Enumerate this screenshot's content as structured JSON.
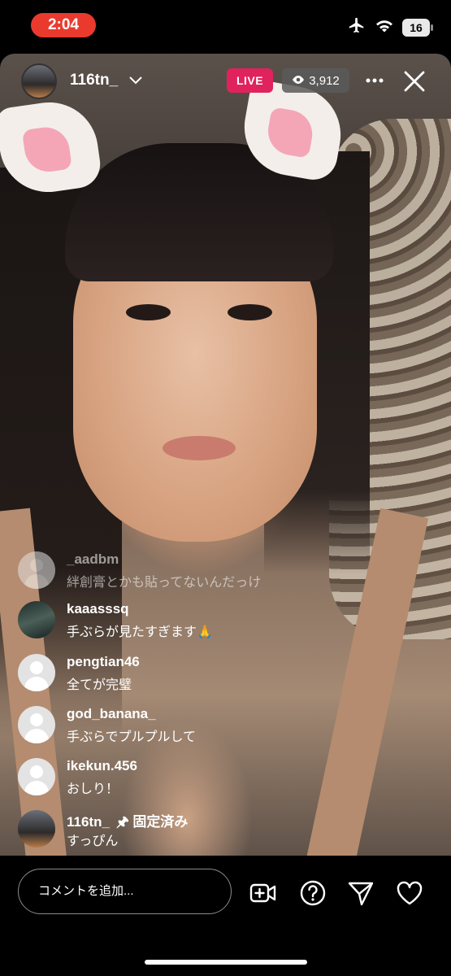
{
  "status_bar": {
    "time": "2:04",
    "battery": "16",
    "icons": [
      "airplane-icon",
      "wifi-icon",
      "battery-icon"
    ]
  },
  "live_header": {
    "host_username": "116tn_",
    "live_label": "LIVE",
    "viewer_count": "3,912",
    "colors": {
      "live_badge": "#e0225d",
      "viewer_badge": "#5a5a5a"
    }
  },
  "comments": [
    {
      "username": "_aadbm",
      "text": "絆創膏とかも貼ってないんだっけ",
      "avatar": "generic",
      "faded": true
    },
    {
      "username": "kaaasssq",
      "text": "手ぶらが見たすぎます🙏",
      "avatar": "photo"
    },
    {
      "username": "pengtian46",
      "text": "全てが完璧",
      "avatar": "generic"
    },
    {
      "username": "god_banana_",
      "text": "手ぶらでプルプルして",
      "avatar": "generic"
    },
    {
      "username": "ikekun.456",
      "text": "おしり！",
      "avatar": "generic"
    },
    {
      "username": "116tn_",
      "pinned_label": "🖈 固定済み",
      "text": "すっぴん",
      "avatar": "host"
    }
  ],
  "bottom_bar": {
    "comment_placeholder": "コメントを追加...",
    "actions": [
      "add-video-icon",
      "question-icon",
      "send-icon",
      "heart-icon"
    ]
  }
}
